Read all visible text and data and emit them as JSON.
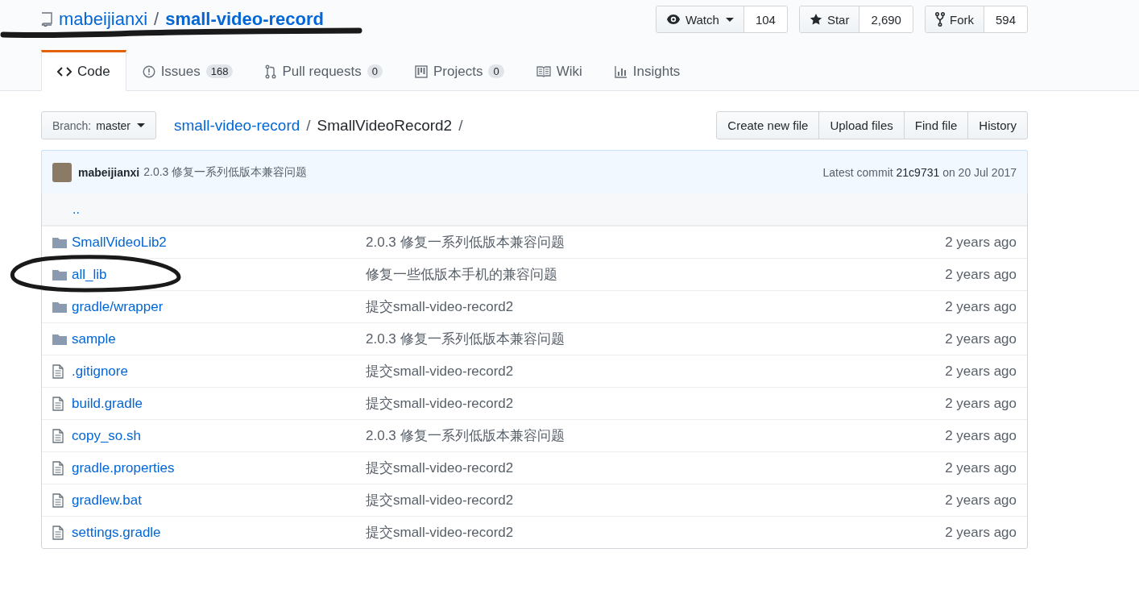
{
  "repo": {
    "owner": "mabeijianxi",
    "name": "small-video-record"
  },
  "actions": [
    {
      "kind": "watch",
      "label": "Watch",
      "count": "104"
    },
    {
      "kind": "star",
      "label": "Star",
      "count": "2,690"
    },
    {
      "kind": "fork",
      "label": "Fork",
      "count": "594"
    }
  ],
  "tabs": [
    {
      "kind": "code",
      "label": "Code",
      "selected": true
    },
    {
      "kind": "issues",
      "label": "Issues",
      "counter": "168",
      "selected": false
    },
    {
      "kind": "pulls",
      "label": "Pull requests",
      "counter": "0",
      "selected": false
    },
    {
      "kind": "projects",
      "label": "Projects",
      "counter": "0",
      "selected": false
    },
    {
      "kind": "wiki",
      "label": "Wiki",
      "selected": false
    },
    {
      "kind": "insights",
      "label": "Insights",
      "selected": false
    }
  ],
  "branch": {
    "prefix": "Branch:",
    "name": "master"
  },
  "breadcrumb": {
    "root": "small-video-record",
    "current": "SmallVideoRecord2",
    "separator": "/"
  },
  "file_buttons": [
    "Create new file",
    "Upload files",
    "Find file",
    "History"
  ],
  "commit": {
    "author": "mabeijianxi",
    "message": "2.0.3 修复一系列低版本兼容问题",
    "latest": "Latest commit",
    "sha": "21c9731",
    "date": "on 20 Jul 2017"
  },
  "parent_link": "..",
  "files": [
    {
      "kind": "dir",
      "name": "SmallVideoLib2",
      "message": "2.0.3 修复一系列低版本兼容问题",
      "age": "2 years ago"
    },
    {
      "kind": "dir",
      "name": "all_lib",
      "message": "修复一些低版本手机的兼容问题",
      "age": "2 years ago"
    },
    {
      "kind": "dir",
      "name": "gradle/wrapper",
      "message": "提交small-video-record2",
      "age": "2 years ago"
    },
    {
      "kind": "dir",
      "name": "sample",
      "message": "2.0.3 修复一系列低版本兼容问题",
      "age": "2 years ago"
    },
    {
      "kind": "file",
      "name": ".gitignore",
      "message": "提交small-video-record2",
      "age": "2 years ago"
    },
    {
      "kind": "file",
      "name": "build.gradle",
      "message": "提交small-video-record2",
      "age": "2 years ago"
    },
    {
      "kind": "file",
      "name": "copy_so.sh",
      "message": "2.0.3 修复一系列低版本兼容问题",
      "age": "2 years ago"
    },
    {
      "kind": "file",
      "name": "gradle.properties",
      "message": "提交small-video-record2",
      "age": "2 years ago"
    },
    {
      "kind": "file",
      "name": "gradlew.bat",
      "message": "提交small-video-record2",
      "age": "2 years ago"
    },
    {
      "kind": "file",
      "name": "settings.gradle",
      "message": "提交small-video-record2",
      "age": "2 years ago"
    }
  ]
}
